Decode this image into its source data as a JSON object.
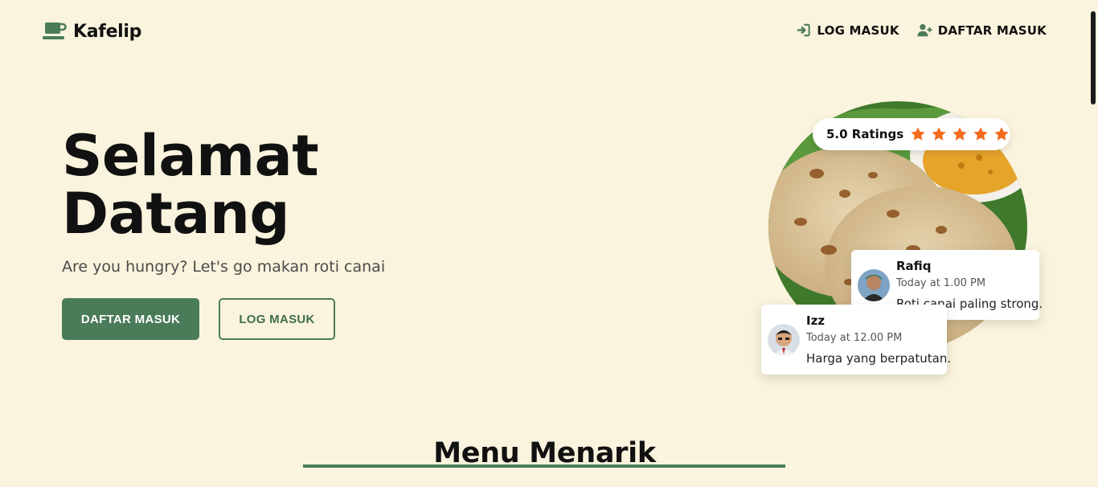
{
  "header": {
    "brand": "Kafelip",
    "brand_icon": "coffee-cup-icon",
    "nav": {
      "login": {
        "label": "LOG MASUK",
        "icon": "sign-in-icon"
      },
      "register": {
        "label": "DAFTAR MASUK",
        "icon": "user-plus-icon"
      }
    }
  },
  "hero": {
    "title_line1": "Selamat",
    "title_line2": "Datang",
    "subtitle": "Are you hungry? Let's go makan roti canai",
    "primary_button": "DAFTAR MASUK",
    "secondary_button": "LOG MASUK"
  },
  "ratings": {
    "label": "5.0 Ratings",
    "stars": 5,
    "star_color": "#f26b1d"
  },
  "reviews": [
    {
      "name": "Rafiq",
      "time": "Today at 1.00 PM",
      "text": "Roti canai paling strong."
    },
    {
      "name": "Izz",
      "time": "Today at 12.00 PM",
      "text": "Harga yang berpatutan."
    }
  ],
  "menu_section": {
    "title": "Menu Menarik"
  },
  "colors": {
    "background": "#faf3dd",
    "accent": "#4a7c59",
    "star": "#f26b1d"
  }
}
